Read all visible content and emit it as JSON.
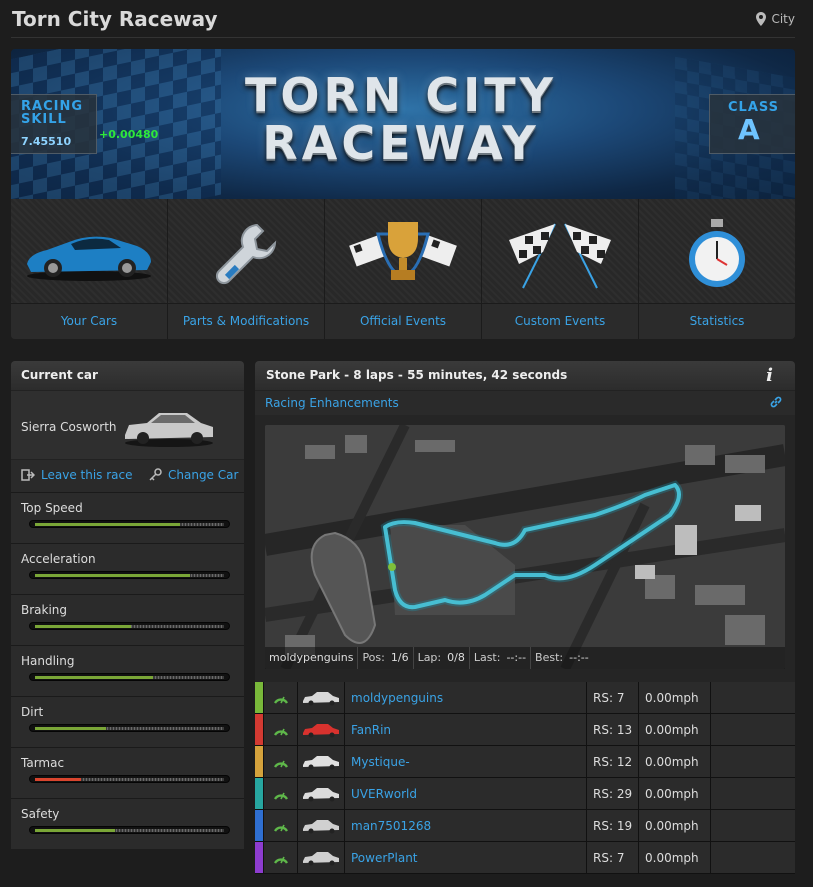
{
  "header": {
    "title": "Torn City Raceway",
    "location": "City",
    "location_icon": "map-pin-icon"
  },
  "banner": {
    "logo_line1": "TORN CITY",
    "logo_line2": "RACEWAY",
    "skill_label_1": "RACING",
    "skill_label_2": "SKILL",
    "skill_value": "7.45510",
    "skill_delta": "+0.00480",
    "class_label": "CLASS",
    "class_value": "A"
  },
  "nav": [
    {
      "label": "Your Cars",
      "icon": "sports-car-icon"
    },
    {
      "label": "Parts & Modifications",
      "icon": "wrench-icon"
    },
    {
      "label": "Official Events",
      "icon": "trophy-icon"
    },
    {
      "label": "Custom Events",
      "icon": "checkered-flags-icon"
    },
    {
      "label": "Statistics",
      "icon": "stopwatch-icon"
    }
  ],
  "current_car": {
    "heading": "Current car",
    "name": "Sierra Cosworth",
    "leave_label": "Leave this race",
    "change_label": "Change Car"
  },
  "stats": [
    {
      "label": "Top Speed",
      "value": 0.76,
      "color": "#7aa637"
    },
    {
      "label": "Acceleration",
      "value": 0.81,
      "color": "#7aa637"
    },
    {
      "label": "Braking",
      "value": 0.5,
      "color": "#7aa637"
    },
    {
      "label": "Handling",
      "value": 0.62,
      "color": "#7aa637"
    },
    {
      "label": "Dirt",
      "value": 0.37,
      "color": "#7aa637"
    },
    {
      "label": "Tarmac",
      "value": 0.24,
      "color": "#d9452e"
    },
    {
      "label": "Safety",
      "value": 0.42,
      "color": "#7aa637"
    }
  ],
  "race": {
    "heading": "Stone Park - 8 laps - 55 minutes, 42 seconds",
    "info_icon": "info-icon",
    "enhancements_label": "Racing Enhancements",
    "link_icon": "link-icon",
    "map_player": "moldypenguins",
    "pos_label": "Pos:",
    "pos_value": "1/6",
    "lap_label": "Lap:",
    "lap_value": "0/8",
    "last_label": "Last:",
    "last_value": "--:--",
    "best_label": "Best:",
    "best_value": "--:--"
  },
  "racers": [
    {
      "name": "moldypenguins",
      "rs": "RS: 7",
      "speed": "0.00mph",
      "color": "#79b83a",
      "car_color": "#d8d8d8"
    },
    {
      "name": "FanRin",
      "rs": "RS: 13",
      "speed": "0.00mph",
      "color": "#d33a32",
      "car_color": "#d8322e"
    },
    {
      "name": "Mystique-",
      "rs": "RS: 12",
      "speed": "0.00mph",
      "color": "#d4a23c",
      "car_color": "#e0e0e0"
    },
    {
      "name": "UVERworld",
      "rs": "RS: 29",
      "speed": "0.00mph",
      "color": "#27a6a0",
      "car_color": "#dcdcdc"
    },
    {
      "name": "man7501268",
      "rs": "RS: 19",
      "speed": "0.00mph",
      "color": "#2f6fd1",
      "car_color": "#d0d0d0"
    },
    {
      "name": "PowerPlant",
      "rs": "RS: 7",
      "speed": "0.00mph",
      "color": "#8d3ccf",
      "car_color": "#d0d0d0"
    }
  ]
}
